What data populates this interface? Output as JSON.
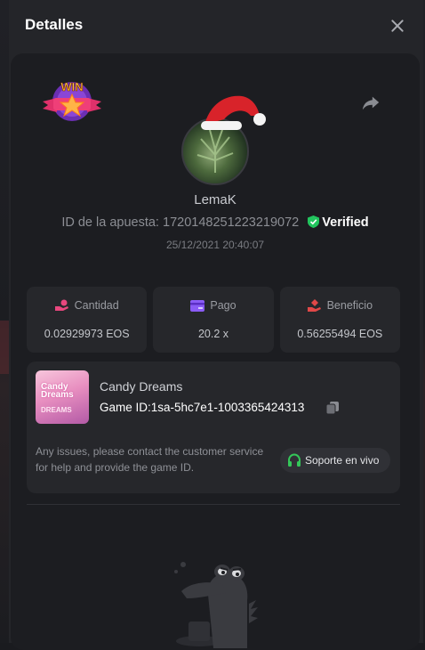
{
  "modal": {
    "title": "Detalles"
  },
  "bet": {
    "username": "LemaK",
    "bet_id_label": "ID de la apuesta:",
    "bet_id": "1720148251223219072",
    "verified_label": "Verified",
    "datetime": "25/12/2021 20:40:07"
  },
  "stats": [
    {
      "label": "Cantidad",
      "value": "0.02929973 EOS",
      "icon": "coin-hand-icon",
      "color": "#e8477e"
    },
    {
      "label": "Pago",
      "value": "20.2 x",
      "icon": "wallet-card-icon",
      "color": "#8b5cf6"
    },
    {
      "label": "Beneficio",
      "value": "0.56255494 EOS",
      "icon": "profit-hand-icon",
      "color": "#e04848"
    }
  ],
  "game": {
    "name": "Candy Dreams",
    "id_label": "Game ID:",
    "id_value": "1sa-5hc7e1-1003365424313",
    "thumbnail_text_1": "Candy Dreams",
    "thumbnail_text_2": "DREAMS"
  },
  "support": {
    "notice": "Any issues, please contact the customer service for help and provide the game ID.",
    "button_label": "Soporte en vivo"
  },
  "badge": {
    "text": "WIN"
  },
  "colors": {
    "verified_green": "#22c55e",
    "headset_green": "#34c759"
  }
}
